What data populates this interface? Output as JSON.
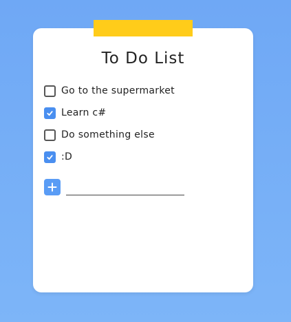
{
  "app": {
    "title": "To Do List"
  },
  "todos": [
    {
      "label": "Go to the supermarket",
      "checked": false
    },
    {
      "label": "Learn c#",
      "checked": true
    },
    {
      "label": "Do something else",
      "checked": false
    },
    {
      "label": ":D",
      "checked": true
    }
  ],
  "add": {
    "button_label": "+",
    "input_value": "",
    "input_placeholder": ""
  },
  "colors": {
    "background": "#6fa8f5",
    "card": "#ffffff",
    "tape": "#ffcc1a",
    "accent": "#4a8ff0"
  },
  "icons": {
    "checkbox_checked": "check-icon",
    "add": "plus-icon"
  }
}
